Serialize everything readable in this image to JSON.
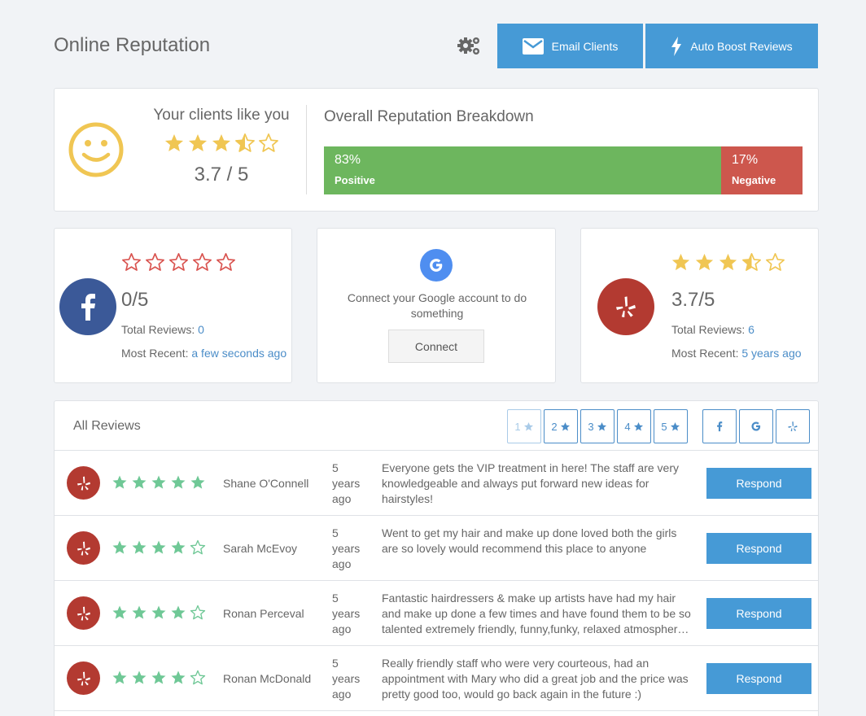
{
  "header": {
    "title": "Online Reputation",
    "email_label": "Email Clients",
    "boost_label": "Auto Boost Reviews"
  },
  "summary": {
    "like_title": "Your clients like you",
    "rating": 3.7,
    "score_text": "3.7 / 5",
    "breakdown_title": "Overall Reputation Breakdown",
    "positive_pct": "83%",
    "positive_label": "Positive",
    "positive_value": 83,
    "negative_pct": "17%",
    "negative_label": "Negative"
  },
  "sources": {
    "facebook": {
      "rating": 0,
      "score_text": "0/5",
      "total_label": "Total Reviews:",
      "total_value": "0",
      "recent_label": "Most Recent:",
      "recent_value": "a few seconds ago"
    },
    "google": {
      "connect_text": "Connect your Google account to do something",
      "connect_label": "Connect"
    },
    "yelp": {
      "rating": 3.7,
      "score_text": "3.7/5",
      "total_label": "Total Reviews:",
      "total_value": "6",
      "recent_label": "Most Recent:",
      "recent_value": "5 years ago"
    }
  },
  "reviews": {
    "title": "All Reviews",
    "filters": [
      "1",
      "2",
      "3",
      "4",
      "5"
    ],
    "respond_label": "Respond",
    "items": [
      {
        "stars": 5,
        "name": "Shane O'Connell",
        "time": "5 years ago",
        "text": "Everyone gets the VIP treatment in here! The staff are very knowledgeable and always put forward new ideas for hairstyles!"
      },
      {
        "stars": 4,
        "name": "Sarah McEvoy",
        "time": "5 years ago",
        "text": "Went to get my hair and make up done loved both the girls are so lovely would recommend this place to anyone"
      },
      {
        "stars": 4,
        "name": "Ronan Perceval",
        "time": "5 years ago",
        "text": "Fantastic hairdressers & make up artists have had my hair and make up done a few times and have found them to be so talented extremely friendly, funny,funky, relaxed atmosphere and great prices would highly recommend"
      },
      {
        "stars": 4,
        "name": "Ronan McDonald",
        "time": "5 years ago",
        "text": "Really friendly staff who were very courteous, had an appointment with Mary who did a great job and the price was pretty good too, would go back again in the future :)"
      }
    ]
  },
  "colors": {
    "primary": "#469ad6",
    "positive": "#6db65e",
    "negative": "#cd574d",
    "gold_star": "#f0c653",
    "red_star": "#d9534f",
    "green_star": "#6fc896",
    "facebook": "#3b5998",
    "yelp": "#b33a31",
    "google": "#4f8ef0"
  }
}
